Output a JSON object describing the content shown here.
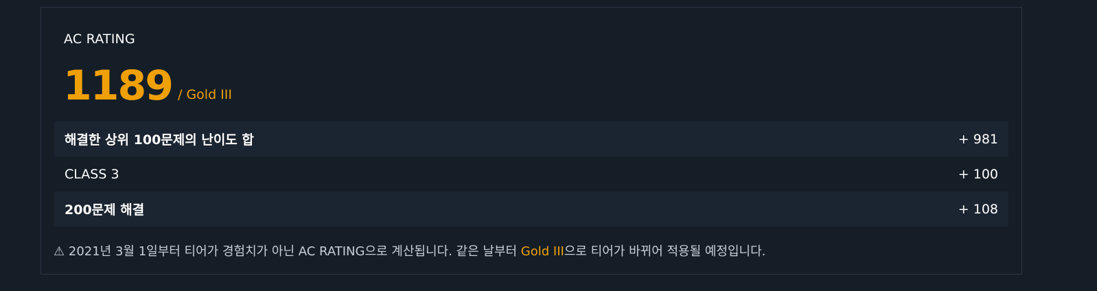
{
  "card": {
    "title": "AC RATING",
    "rating": "1189",
    "tier": "/ Gold III"
  },
  "rows": [
    {
      "label": "해결한 상위 100문제의 난이도 합",
      "value": "+ 981"
    },
    {
      "label": "CLASS 3",
      "value": "+ 100"
    },
    {
      "label": "200문제 해결",
      "value": "+ 108"
    }
  ],
  "notice": {
    "icon": "⚠",
    "before": "2021년 3월 1일부터 티어가 경험치가 아닌 AC RATING으로 계산됩니다. 같은 날부터 ",
    "highlight": "Gold III",
    "after": "으로 티어가 바뀌어 적용될 예정입니다."
  },
  "colors": {
    "background": "#151e27",
    "accent": "#f0a007",
    "row_shade": "#1b2531",
    "border": "#2a3541"
  }
}
